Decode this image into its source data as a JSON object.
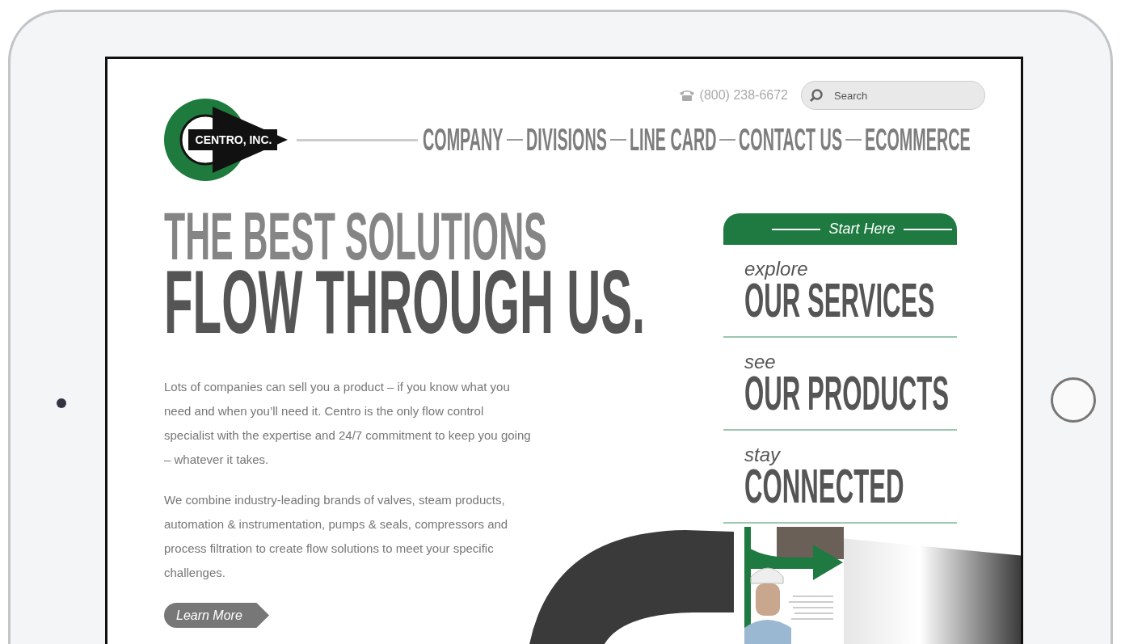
{
  "header": {
    "logo_text": "CENTRO, INC.",
    "phone": "(800) 238-6672",
    "search": {
      "placeholder": "Search"
    },
    "nav": [
      "COMPANY",
      "DIVISIONS",
      "LINE CARD",
      "CONTACT US",
      "ECOMMERCE"
    ]
  },
  "hero": {
    "headline": [
      "THE BEST SOLUTIONS",
      "FLOW THROUGH US."
    ],
    "paragraphs": [
      "Lots of companies can sell you a product – if you know what you need and when you’ll need it. Centro is the only flow control specialist with the expertise and 24/7 commitment to keep you going – whatever it takes.",
      "We combine industry-leading brands of valves, steam products, automation & instrumentation, pumps & seals, compressors and process filtration to create flow solutions to meet your specific challenges."
    ],
    "button": "Learn More"
  },
  "start_panel": {
    "title": "Start Here",
    "items": [
      {
        "small": "explore",
        "big": "OUR SERVICES"
      },
      {
        "small": "see",
        "big": "OUR PRODUCTS"
      },
      {
        "small": "stay",
        "big": "CONNECTED"
      }
    ]
  }
}
